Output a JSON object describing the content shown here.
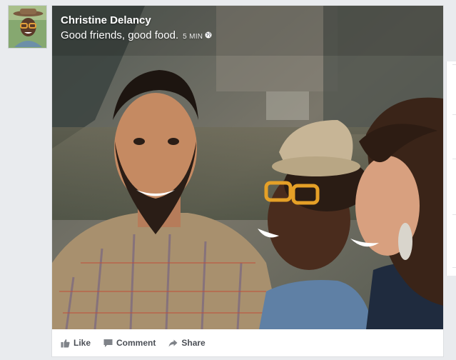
{
  "post": {
    "author": "Christine Delancy",
    "caption": "Good friends, good food.",
    "time": "5 MIN",
    "privacy_icon": "globe-icon"
  },
  "actions": [
    {
      "label": "Like",
      "icon": "thumbs-up-icon"
    },
    {
      "label": "Comment",
      "icon": "comment-icon"
    },
    {
      "label": "Share",
      "icon": "share-icon"
    }
  ],
  "colors": {
    "page_background": "#e9ebee",
    "action_text": "#4b4f56",
    "card_border": "#dddfe2"
  }
}
